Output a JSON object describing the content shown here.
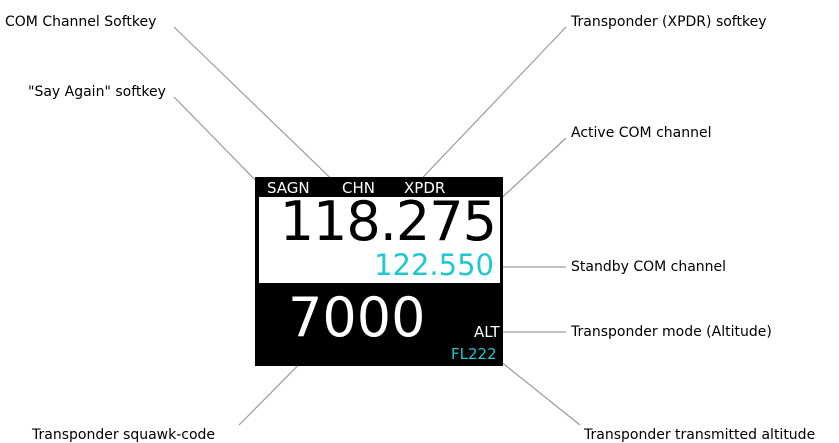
{
  "callouts": {
    "com_channel_softkey": "COM Channel Softkey",
    "say_again_softkey": "\"Say Again\" softkey",
    "transponder_softkey": "Transponder (XPDR) softkey",
    "active_com_channel": "Active COM channel",
    "standby_com_channel": "Standby COM channel",
    "transponder_mode": "Transponder mode (Altitude)",
    "squawk_code": "Transponder squawk-code",
    "transmitted_altitude": "Transponder transmitted altitude"
  },
  "display": {
    "softkeys": [
      "SAGN",
      "CHN",
      "XPDR"
    ],
    "active_frequency": "118.275",
    "standby_frequency": "122.550",
    "squawk_code": "7000",
    "transponder_mode": "ALT",
    "transmitted_altitude": "FL222"
  },
  "colors": {
    "background": "#000000",
    "active_panel": "#ffffff",
    "standby_text": "#1fc7cf",
    "altitude_text": "#1fc7cf",
    "leader_lines": "#9a9a9a"
  }
}
